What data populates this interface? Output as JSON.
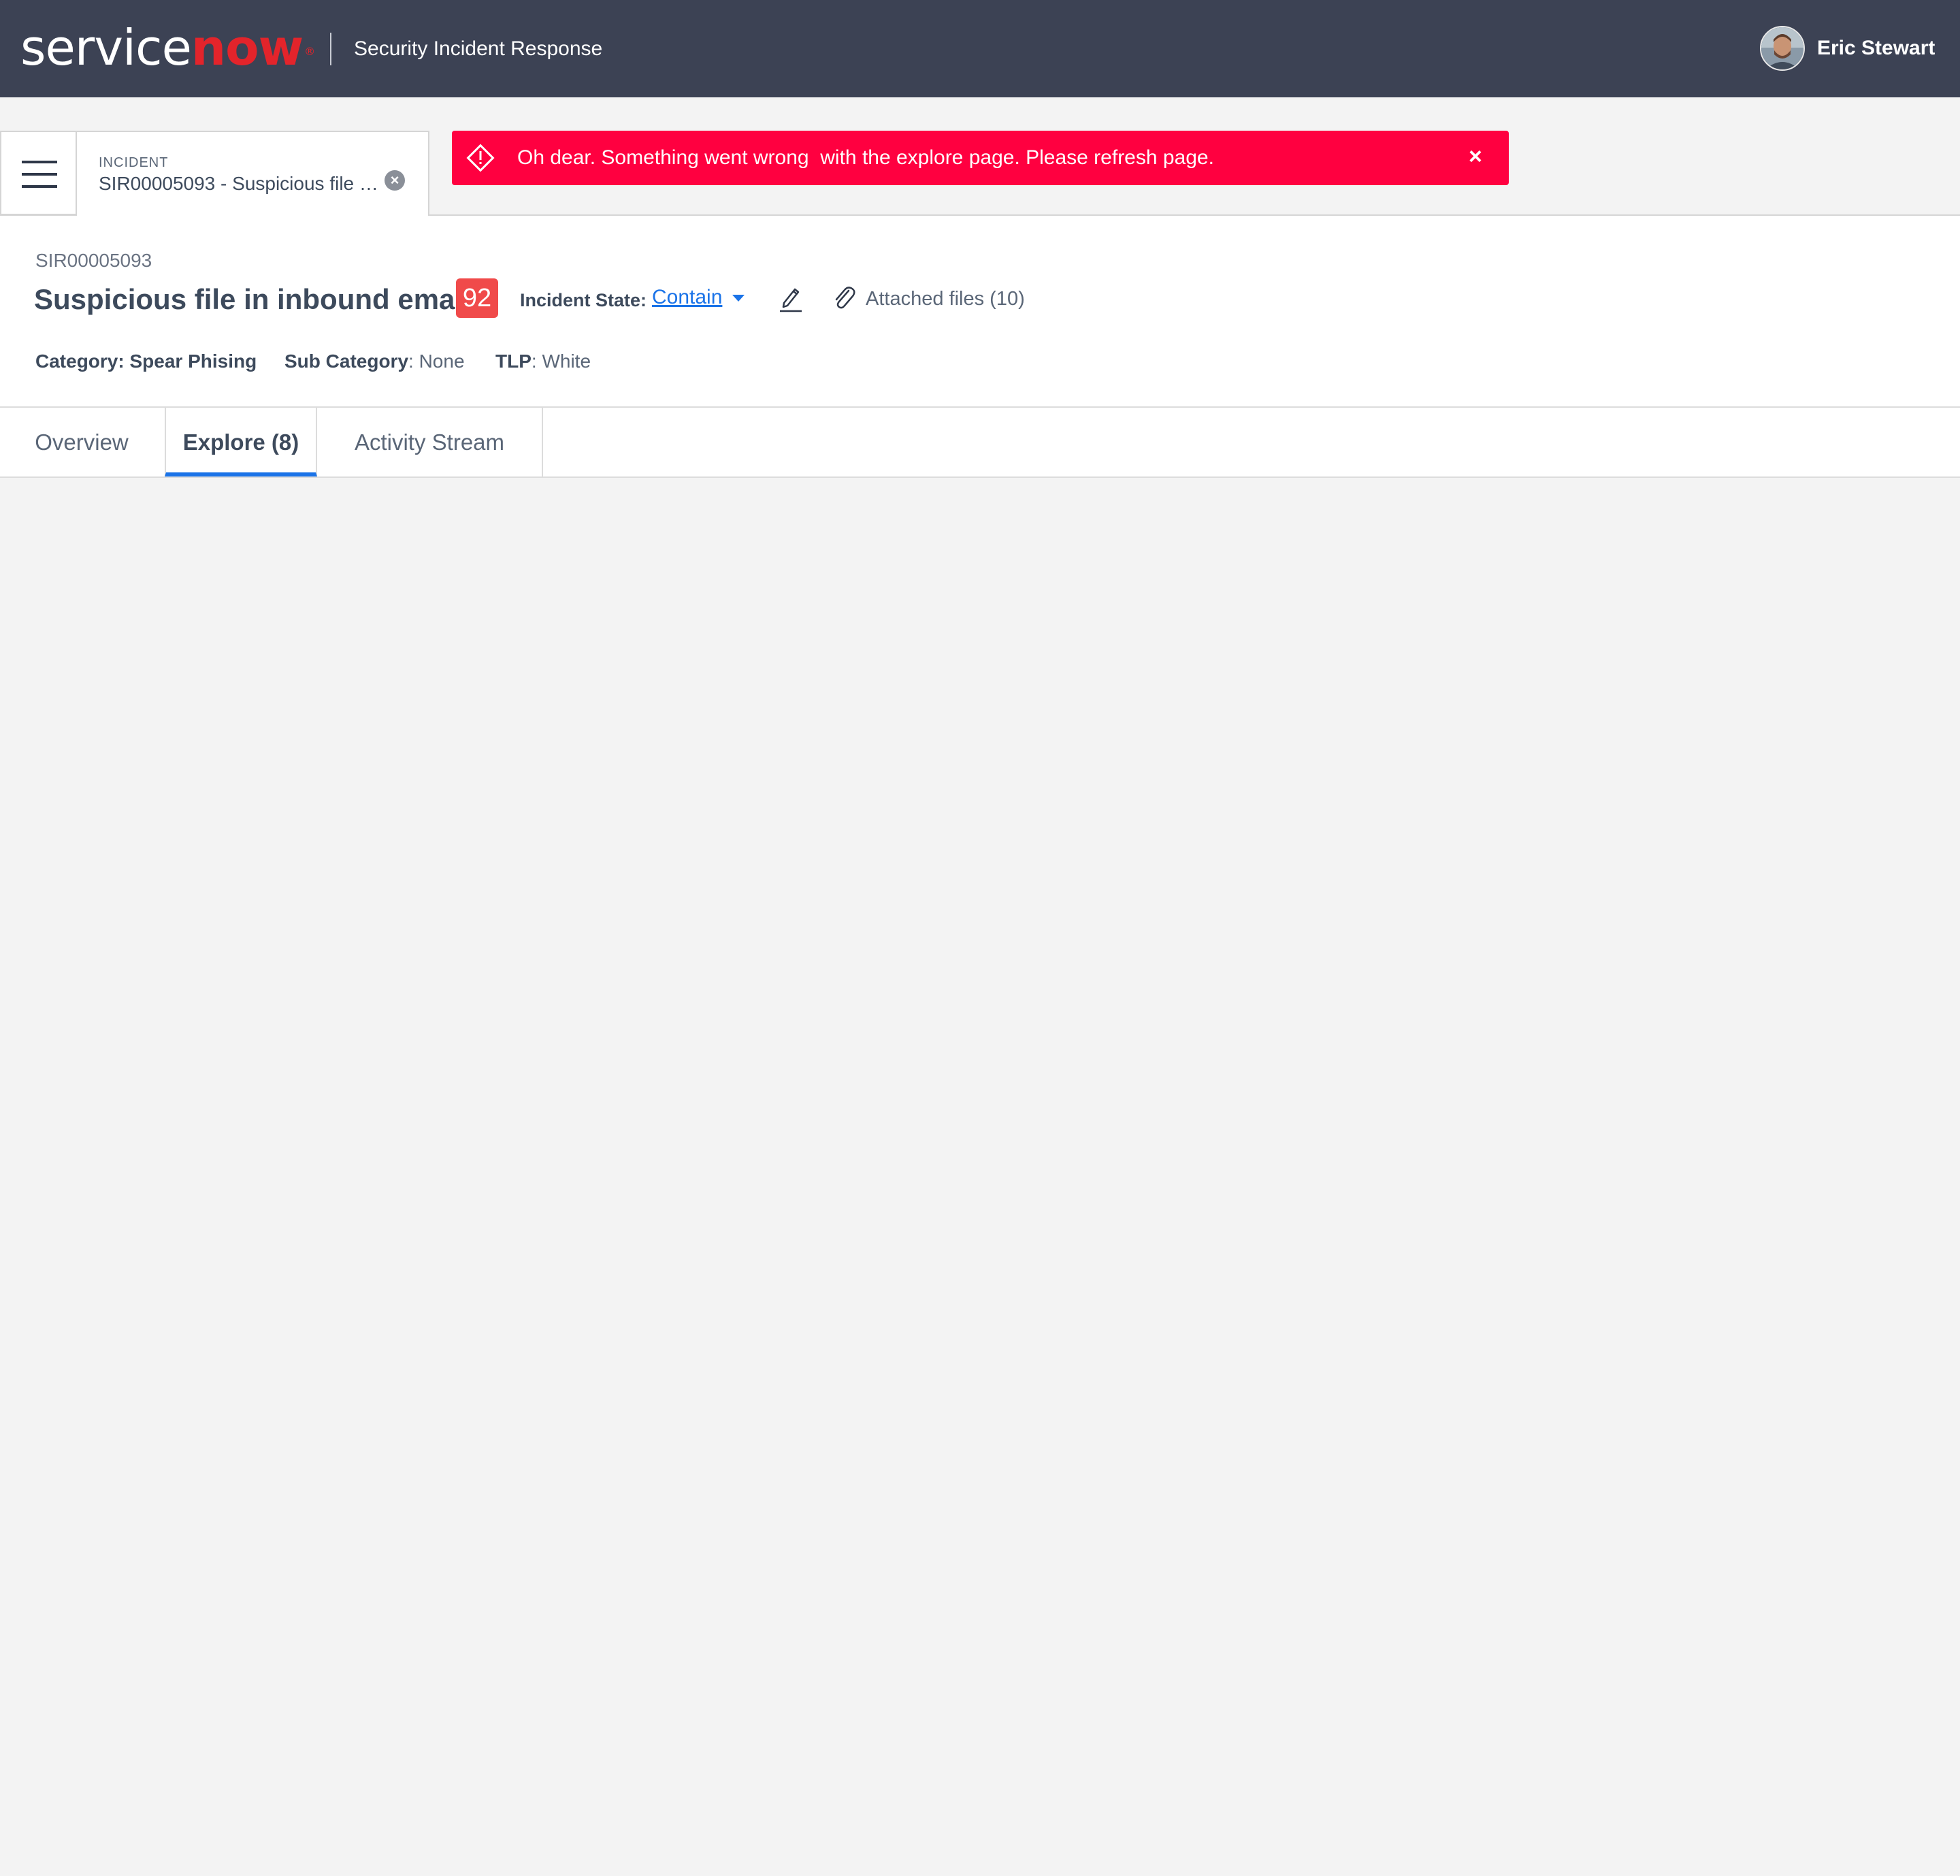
{
  "topbar": {
    "logo_service": "service",
    "logo_now": "now",
    "logo_tm": "®",
    "app_name": "Security Incident Response",
    "user_name": "Eric Stewart",
    "background_color": "#3c4254"
  },
  "doc_tab": {
    "type_label": "INCIDENT",
    "title": "SIR00005093 - Suspicious file …"
  },
  "alert": {
    "message": "Oh dear. Something went wrong  with the explore page. Please refresh page.",
    "close_symbol": "×",
    "color": "#ff0040"
  },
  "record": {
    "id": "SIR00005093",
    "title": "Suspicious file in inbound email",
    "risk_score": "92",
    "state_label": "Incident State:",
    "state_value": "Contain",
    "attachments": "Attached files (10)",
    "category_label": "Category:",
    "category_value": "Spear Phising",
    "subcategory_label": "Sub Category",
    "subcategory_value": ": None",
    "tlp_label": "TLP",
    "tlp_value": ": White"
  },
  "tabs": [
    {
      "label": "Overview",
      "active": false
    },
    {
      "label": "Explore (8)",
      "active": true
    },
    {
      "label": "Activity Stream",
      "active": false
    }
  ],
  "accent_color": "#1a73e8"
}
